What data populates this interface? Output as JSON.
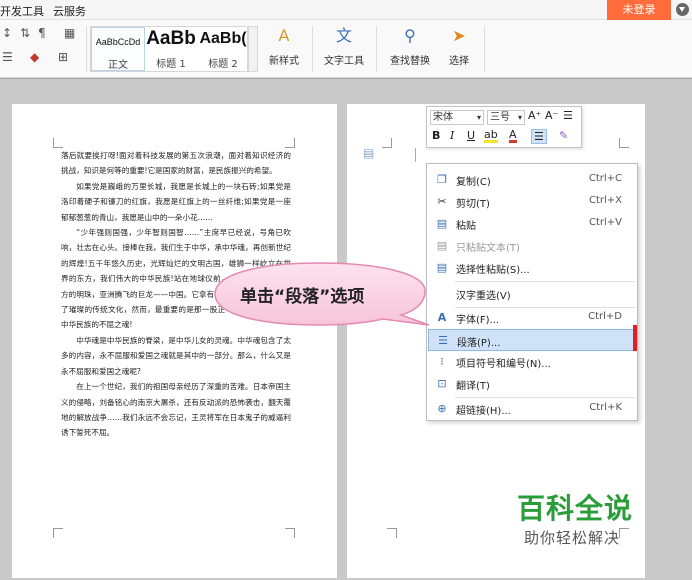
{
  "menu": {
    "items": [
      "开发工具",
      "云服务"
    ],
    "login_label": "未登录"
  },
  "ribbon": {
    "styles": [
      {
        "sample": "AaBbCcDd",
        "name": "正文"
      },
      {
        "sample": "AaBb",
        "name": "标题 1"
      },
      {
        "sample": "AaBb(",
        "name": "标题 2"
      }
    ],
    "buttons": {
      "new_style": "新样式",
      "text_tools": "文字工具",
      "find_replace": "查找替换",
      "select": "选择"
    }
  },
  "mini_toolbar": {
    "font": "宋体",
    "size": "三号",
    "grow_label": "A⁺",
    "shrink_label": "A⁻"
  },
  "document": {
    "paragraphs": [
      "落后就要挨打呀!面对着科技发展的第五次浪潮，面对着知识经济的挑战，知识是何等的重要!它是国家的财富，是民族振兴的希望。",
      "如果党是巍峨的万里长城，我愿是长城上的一块石砖;如果党是洛印着硬子和镰刀的红旗，我愿是红旗上的一丝纤维;如果党是一座郁郁葱葱的青山，我愿是山中的一朵小花……",
      "“少年强则国强，少年智则国智……”主席早已经说，号角已吹响，壮志在心头。接棒在我，我们生于中华，承中华魂，再创新世纪的辉煌!五千年悠久历史，光辉灿烂的文明古国，雄狮一样屹立在世界的东方，我们伟大的中华民族!站在地球仪前，一眼望到的是那东方的明珠，亚洲腾飞的巨龙——中国。它拿有了五千年的文明，发扬了璀璨的传统文化，然而，最重要的是那一股正气永存的魂魄!一般中华民族的不屈之魂!",
      "中华魂是中华民族的脊梁，是中华儿女的灵魂。中华魂包含了太多的内容，永不屈服和爱国之魂就是其中的一部分。那么，什么又是永不屈服和爱国之魂呢?",
      "在上一个世纪，我们的祖国母亲经历了深重的苦难。日本帝国主义的侵略，刘备铭心的南京大屠杀，还有反动派的恐怖袭击，翻天覆地的解放战争……我们永远不会忘记，王灵将军在日本鬼子的威逼利诱下誓死不屈。"
    ]
  },
  "context_menu": {
    "items": [
      {
        "icon": "copy-icon",
        "label": "复制(C)",
        "shortcut": "Ctrl+C",
        "disabled": false
      },
      {
        "icon": "cut-icon",
        "label": "剪切(T)",
        "shortcut": "Ctrl+X",
        "disabled": false
      },
      {
        "icon": "paste-icon",
        "label": "粘贴",
        "shortcut": "Ctrl+V",
        "disabled": false
      },
      {
        "icon": "paste-text-icon",
        "label": "只粘贴文本(T)",
        "shortcut": "",
        "disabled": true
      },
      {
        "icon": "paste-special-icon",
        "label": "选择性粘贴(S)...",
        "shortcut": "",
        "disabled": false
      },
      {
        "icon": "",
        "label": "汉字重选(V)",
        "shortcut": "",
        "disabled": false
      },
      {
        "icon": "font-icon",
        "label": "字体(F)...",
        "shortcut": "Ctrl+D",
        "disabled": false
      },
      {
        "icon": "paragraph-icon",
        "label": "段落(P)...",
        "shortcut": "",
        "disabled": false
      },
      {
        "icon": "list-icon",
        "label": "项目符号和编号(N)...",
        "shortcut": "",
        "disabled": false
      },
      {
        "icon": "translate-icon",
        "label": "翻译(T)",
        "shortcut": "",
        "disabled": false
      },
      {
        "icon": "hyperlink-icon",
        "label": "超链接(H)...",
        "shortcut": "Ctrl+K",
        "disabled": false
      }
    ],
    "highlighted_index": 7
  },
  "callout": {
    "text": "单击“段落”选项"
  },
  "watermark": {
    "title": "百科全说",
    "subtitle": "助你轻松解决"
  }
}
